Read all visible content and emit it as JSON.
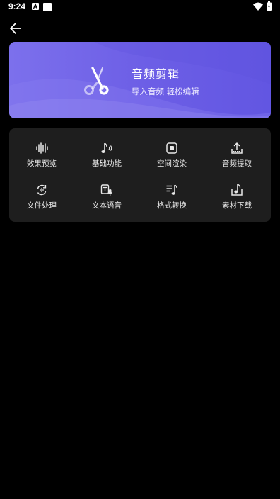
{
  "status_bar": {
    "time": "9:24",
    "icons": [
      "a-notification-icon",
      "square-notification-icon",
      "wifi-icon",
      "battery-icon"
    ]
  },
  "nav": {
    "back_icon": "arrow-left-icon"
  },
  "banner": {
    "title": "音频剪辑",
    "subtitle": "导入音频 轻松编辑",
    "icon": "scissors-cut-icon",
    "colors": {
      "start": "#7c70ec",
      "end": "#6256e2"
    }
  },
  "tools": [
    {
      "label": "效果预览",
      "icon": "waveform-icon"
    },
    {
      "label": "基础功能",
      "icon": "music-note-sound-icon"
    },
    {
      "label": "空间渲染",
      "icon": "spatial-chip-icon"
    },
    {
      "label": "音频提取",
      "icon": "extract-upload-icon"
    },
    {
      "label": "文件处理",
      "icon": "file-process-icon"
    },
    {
      "label": "文本语音",
      "icon": "text-to-speech-icon"
    },
    {
      "label": "格式转换",
      "icon": "format-convert-icon"
    },
    {
      "label": "素材下载",
      "icon": "material-download-icon"
    }
  ],
  "colors": {
    "background": "#000000",
    "panel": "#1e1e1e",
    "text": "#e8e8e8"
  }
}
